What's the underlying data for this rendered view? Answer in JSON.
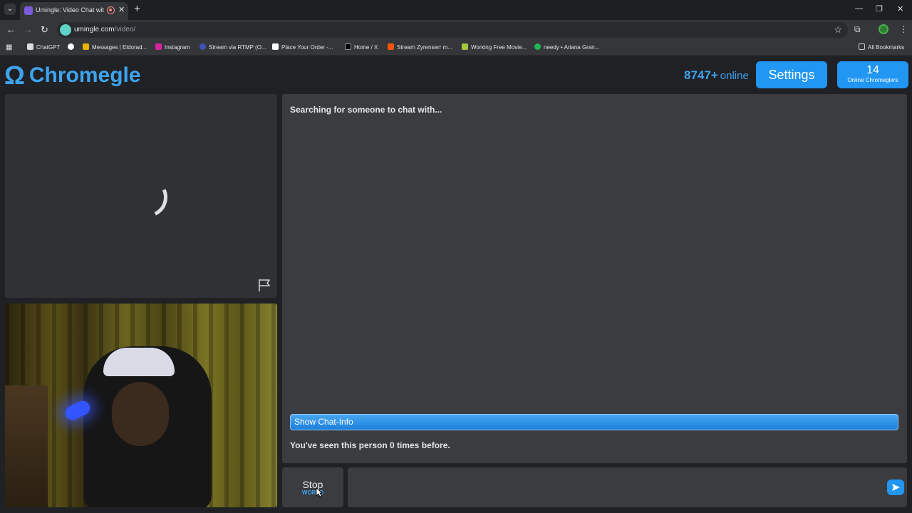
{
  "browser": {
    "tab_title": "Umingle: Video Chat with S",
    "url_domain": "umingle.com",
    "url_path": "/video/",
    "bookmarks": [
      {
        "label": "ChatGPT"
      },
      {
        "label": "Messages | Eldorad..."
      },
      {
        "label": "Instagram"
      },
      {
        "label": "Stream via RTMP (O..."
      },
      {
        "label": "Place Your Order -..."
      },
      {
        "label": "Home / X"
      },
      {
        "label": "Stream Zyrenserr m..."
      },
      {
        "label": "Working Free Movie..."
      },
      {
        "label": "needy • Ariana Gran..."
      }
    ],
    "all_bookmarks": "All Bookmarks"
  },
  "header": {
    "logo_symbol": "Ω",
    "logo_text": "Chromegle",
    "online_count": "8747",
    "online_plus": "+",
    "online_word": "online",
    "settings_label": "Settings",
    "chromeglers_count": "14",
    "chromeglers_label": "Online Chromeglers"
  },
  "chat": {
    "status": "Searching for someone to chat with...",
    "show_info_label": "Show Chat-Info",
    "seen_text": "You've seen this person 0 times before."
  },
  "controls": {
    "stop_label": "Stop",
    "stop_sub": "WORLD",
    "message_value": ""
  },
  "colors": {
    "accent": "#3ea3ee",
    "button_blue": "#2196f3",
    "panel": "#3a3c40",
    "background": "#1f2124"
  },
  "icons": {
    "report": "flag-icon",
    "send": "send-arrow-icon",
    "loading": "spinner-icon"
  }
}
